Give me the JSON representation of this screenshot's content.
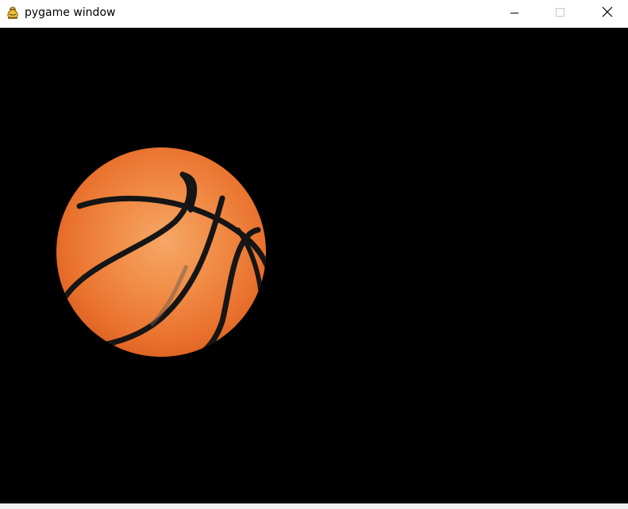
{
  "window": {
    "title": "pygame window",
    "app_icon": "pygame-snake-icon",
    "controls": {
      "minimize_icon": "minimize-icon",
      "maximize_icon": "maximize-icon",
      "close_icon": "close-icon"
    }
  },
  "canvas": {
    "background_color": "#000000",
    "sprite": {
      "name": "basketball",
      "icon": "basketball-icon",
      "color": "#f0853a"
    }
  }
}
